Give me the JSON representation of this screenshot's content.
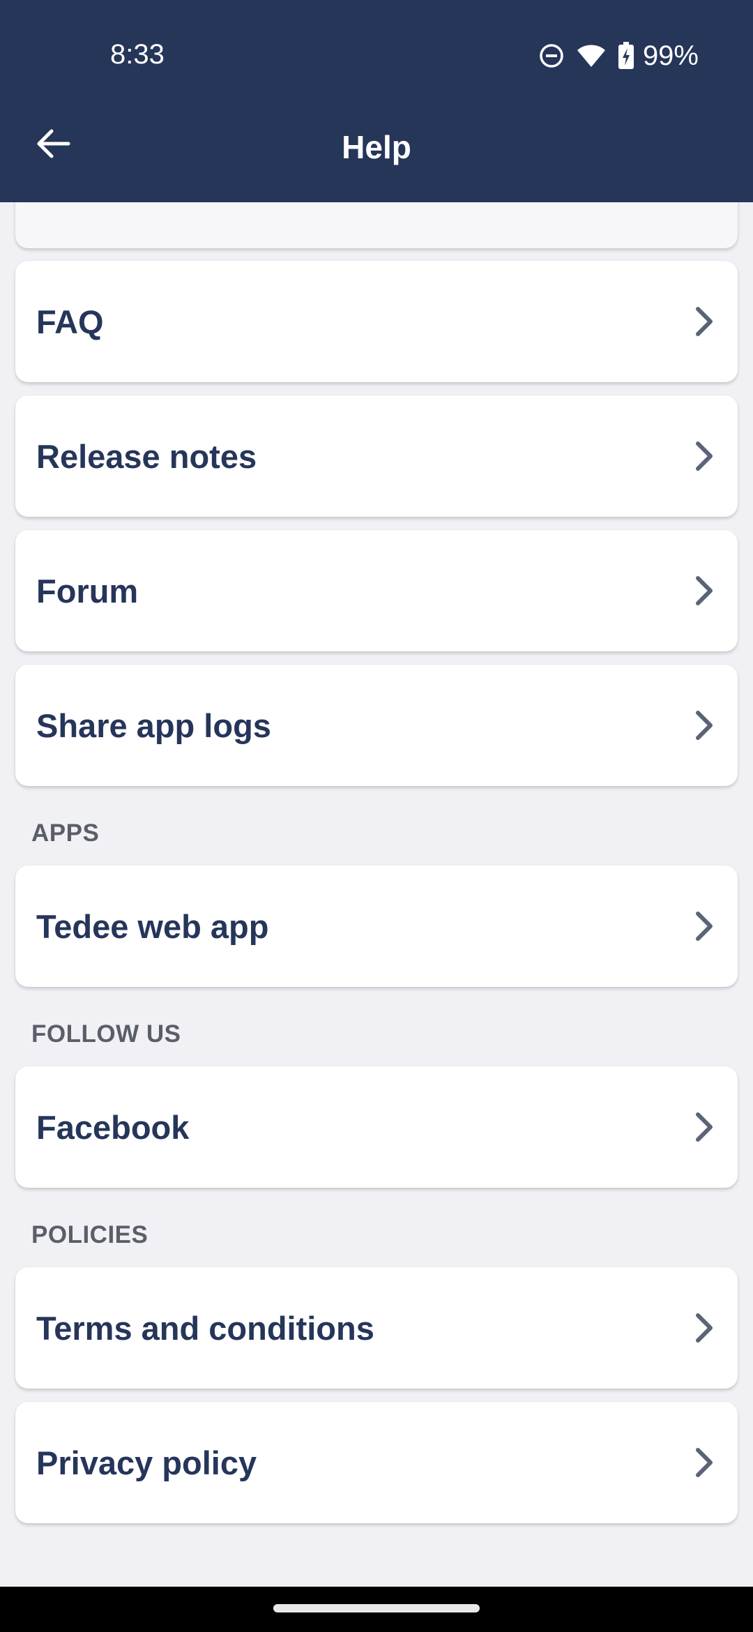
{
  "status_bar": {
    "time": "8:33",
    "battery_percent": "99%",
    "icons": [
      "do-not-disturb-icon",
      "wifi-icon",
      "battery-charging-icon"
    ]
  },
  "app_bar": {
    "title": "Help",
    "back_icon": "arrow-back-icon"
  },
  "colors": {
    "header_bg": "#263659",
    "card_text": "#26355a",
    "chevron": "#5b6378",
    "page_bg": "#f1f1f5",
    "section_label": "#5a5e68"
  },
  "support_items": [
    {
      "label": "FAQ"
    },
    {
      "label": "Release notes"
    },
    {
      "label": "Forum"
    },
    {
      "label": "Share app logs"
    }
  ],
  "sections": {
    "apps": {
      "title": "APPS",
      "items": [
        {
          "label": "Tedee web app"
        }
      ]
    },
    "follow_us": {
      "title": "FOLLOW US",
      "items": [
        {
          "label": "Facebook"
        }
      ]
    },
    "policies": {
      "title": "POLICIES",
      "items": [
        {
          "label": "Terms and conditions"
        },
        {
          "label": "Privacy policy"
        }
      ]
    }
  }
}
